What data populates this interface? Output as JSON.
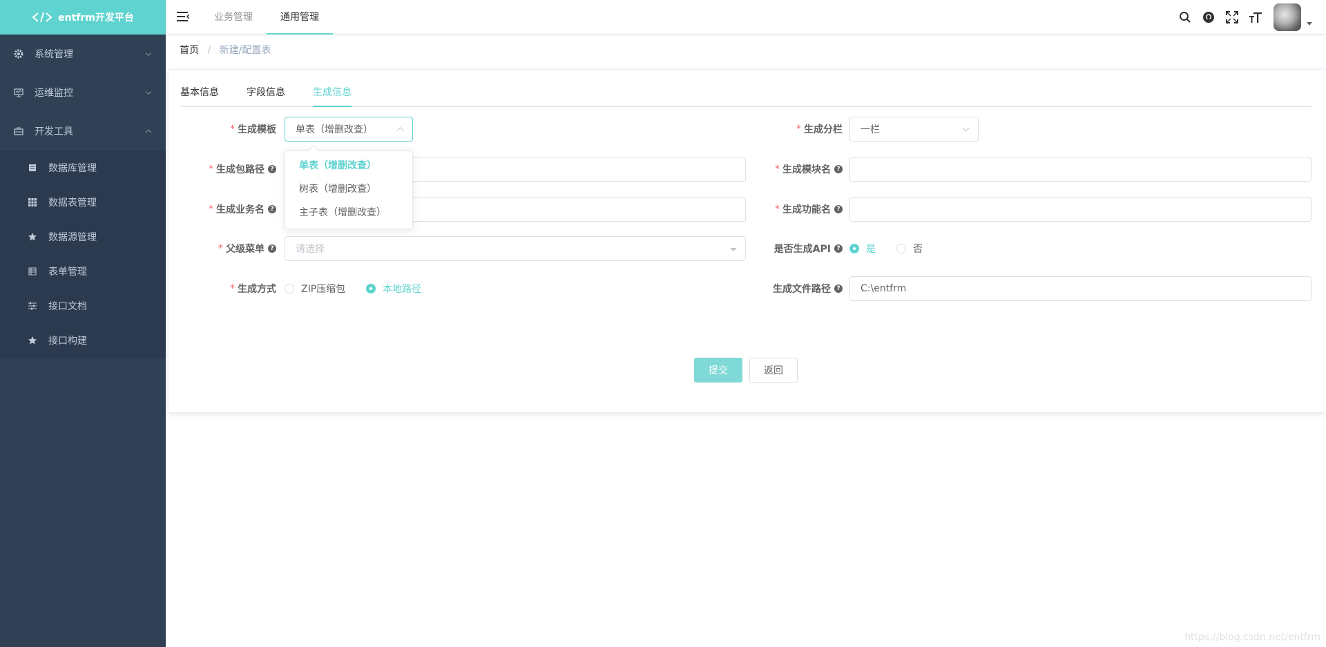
{
  "app": {
    "logo_text": "entfrm开发平台"
  },
  "sidebar": {
    "groups": [
      {
        "label": "系统管理",
        "icon": "gear-icon",
        "expanded": false
      },
      {
        "label": "运维监控",
        "icon": "monitor-icon",
        "expanded": false
      },
      {
        "label": "开发工具",
        "icon": "briefcase-icon",
        "expanded": true
      }
    ],
    "sub_items": [
      {
        "label": "数据库管理",
        "icon": "database-icon"
      },
      {
        "label": "数据表管理",
        "icon": "table-grid-icon"
      },
      {
        "label": "数据源管理",
        "icon": "star-icon"
      },
      {
        "label": "表单管理",
        "icon": "form-icon"
      },
      {
        "label": "接口文档",
        "icon": "sliders-icon"
      },
      {
        "label": "接口构建",
        "icon": "star-icon"
      }
    ]
  },
  "topbar": {
    "nav": [
      {
        "label": "业务管理",
        "active": false
      },
      {
        "label": "通用管理",
        "active": true
      }
    ]
  },
  "breadcrumb": {
    "home": "首页",
    "sep": "/",
    "current": "新建/配置表"
  },
  "tabs": [
    {
      "label": "基本信息",
      "active": false
    },
    {
      "label": "字段信息",
      "active": false
    },
    {
      "label": "生成信息",
      "active": true
    }
  ],
  "form": {
    "template": {
      "label": "生成模板",
      "value": "单表（增删改查）"
    },
    "columns": {
      "label": "生成分栏",
      "value": "一栏"
    },
    "package_path": {
      "label": "生成包路径",
      "value": ""
    },
    "module_name": {
      "label": "生成模块名",
      "value": ""
    },
    "business_name": {
      "label": "生成业务名",
      "value": ""
    },
    "function_name": {
      "label": "生成功能名",
      "value": ""
    },
    "parent_menu": {
      "label": "父级菜单",
      "placeholder": "请选择"
    },
    "gen_api": {
      "label": "是否生成API",
      "options": [
        "是",
        "否"
      ],
      "selected": 0
    },
    "gen_type": {
      "label": "生成方式",
      "options": [
        "ZIP压缩包",
        "本地路径"
      ],
      "selected": 1
    },
    "gen_path": {
      "label": "生成文件路径",
      "value": "C:\\entfrm"
    },
    "required_mark": "*",
    "help_mark": "?"
  },
  "dropdown": {
    "options": [
      "单表（增删改查）",
      "树表（增删改查）",
      "主子表（增删改查）"
    ],
    "selected": 0
  },
  "buttons": {
    "submit": "提交",
    "back": "返回"
  },
  "watermark": "https://blog.csdn.net/entfrm",
  "colors": {
    "accent": "#5fd3cf",
    "sidebar_bg": "#304156",
    "required": "#f56c6c"
  }
}
